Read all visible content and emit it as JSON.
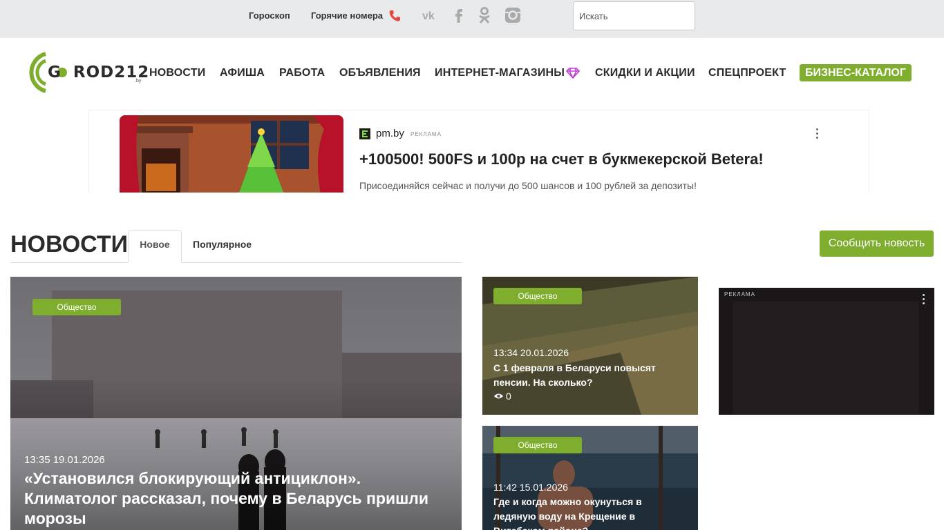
{
  "topbar": {
    "horoscope": "Гороскоп",
    "hot_numbers": "Горячие номера",
    "social": [
      "vk-icon",
      "facebook-icon",
      "odnoklassniki-icon",
      "instagram-icon"
    ],
    "search_placeholder": "Искать"
  },
  "logo": {
    "text": "G O ROD212",
    "domain": ".by"
  },
  "nav": {
    "items": [
      "НОВОСТИ",
      "АФИША",
      "РАБОТА",
      "ОБЪЯВЛЕНИЯ",
      "ИНТЕРНЕТ-МАГАЗИНЫ",
      "СКИДКИ И АКЦИИ",
      "СПЕЦПРОЕКТ"
    ],
    "business": "БИЗНЕС-КАТАЛОГ"
  },
  "ad": {
    "source": "pm.by",
    "tag": "РЕКЛАМА",
    "title": "+100500! 500FS и 100р на счет в букмекерской Betera!",
    "description": "Присоединяйся сейчас и получи до 500 шансов и 100 рублей за депозиты!"
  },
  "news": {
    "heading": "НОВОСТИ",
    "tabs": [
      "Новое",
      "Популярное"
    ],
    "report_button": "Сообщить новость",
    "cards": [
      {
        "category": "Общество",
        "date": "13:35 19.01.2026",
        "title": "«Установился блокирующий антициклон». Климатолог рассказал, почему в Беларусь пришли морозы"
      },
      {
        "category": "Общество",
        "date": "13:34 20.01.2026",
        "title": "С 1 февраля в Беларуси повысят пенсии. На сколько?",
        "views": "0"
      },
      {
        "category": "Общество",
        "date": "11:42 15.01.2026",
        "title": "Где и когда можно окунуться в ледяную воду на Крещение в Витебском районе?"
      }
    ]
  },
  "ad2": {
    "tag": "РЕКЛАМА"
  },
  "colors": {
    "accent": "#7fae2e",
    "topbar": "#e8eaeb"
  }
}
